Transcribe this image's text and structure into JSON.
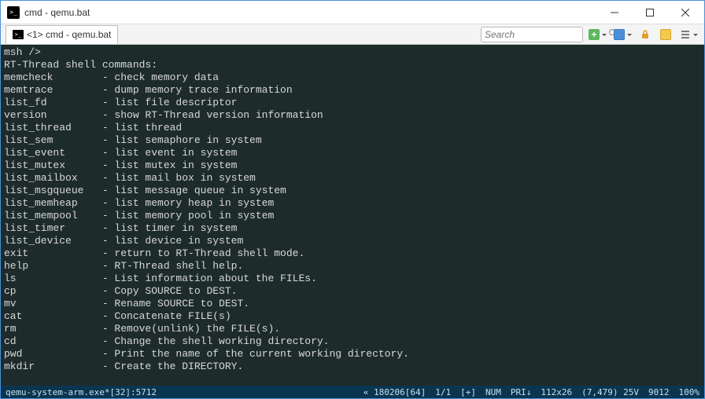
{
  "window": {
    "title": "cmd - qemu.bat"
  },
  "tab": {
    "label": "<1> cmd - qemu.bat"
  },
  "search": {
    "placeholder": "Search"
  },
  "terminal": {
    "prompt": "msh />",
    "header": "RT-Thread shell commands:",
    "commands": [
      {
        "name": "memcheck",
        "desc": "check memory data"
      },
      {
        "name": "memtrace",
        "desc": "dump memory trace information"
      },
      {
        "name": "list_fd",
        "desc": "list file descriptor"
      },
      {
        "name": "version",
        "desc": "show RT-Thread version information"
      },
      {
        "name": "list_thread",
        "desc": "list thread"
      },
      {
        "name": "list_sem",
        "desc": "list semaphore in system"
      },
      {
        "name": "list_event",
        "desc": "list event in system"
      },
      {
        "name": "list_mutex",
        "desc": "list mutex in system"
      },
      {
        "name": "list_mailbox",
        "desc": "list mail box in system"
      },
      {
        "name": "list_msgqueue",
        "desc": "list message queue in system"
      },
      {
        "name": "list_memheap",
        "desc": "list memory heap in system"
      },
      {
        "name": "list_mempool",
        "desc": "list memory pool in system"
      },
      {
        "name": "list_timer",
        "desc": "list timer in system"
      },
      {
        "name": "list_device",
        "desc": "list device in system"
      },
      {
        "name": "exit",
        "desc": "return to RT-Thread shell mode."
      },
      {
        "name": "help",
        "desc": "RT-Thread shell help."
      },
      {
        "name": "ls",
        "desc": "List information about the FILEs."
      },
      {
        "name": "cp",
        "desc": "Copy SOURCE to DEST."
      },
      {
        "name": "mv",
        "desc": "Rename SOURCE to DEST."
      },
      {
        "name": "cat",
        "desc": "Concatenate FILE(s)"
      },
      {
        "name": "rm",
        "desc": "Remove(unlink) the FILE(s)."
      },
      {
        "name": "cd",
        "desc": "Change the shell working directory."
      },
      {
        "name": "pwd",
        "desc": "Print the name of the current working directory."
      },
      {
        "name": "mkdir",
        "desc": "Create the DIRECTORY."
      }
    ]
  },
  "statusbar": {
    "process": "qemu-system-arm.exe*[32]:5712",
    "build": "« 180206[64]",
    "pos": "1/1",
    "cursor": "[+]",
    "num": "NUM",
    "pri": "PRI↓",
    "size": "112x26",
    "coords": "(7,479) 25V",
    "mem": "9012",
    "zoom": "100%"
  }
}
